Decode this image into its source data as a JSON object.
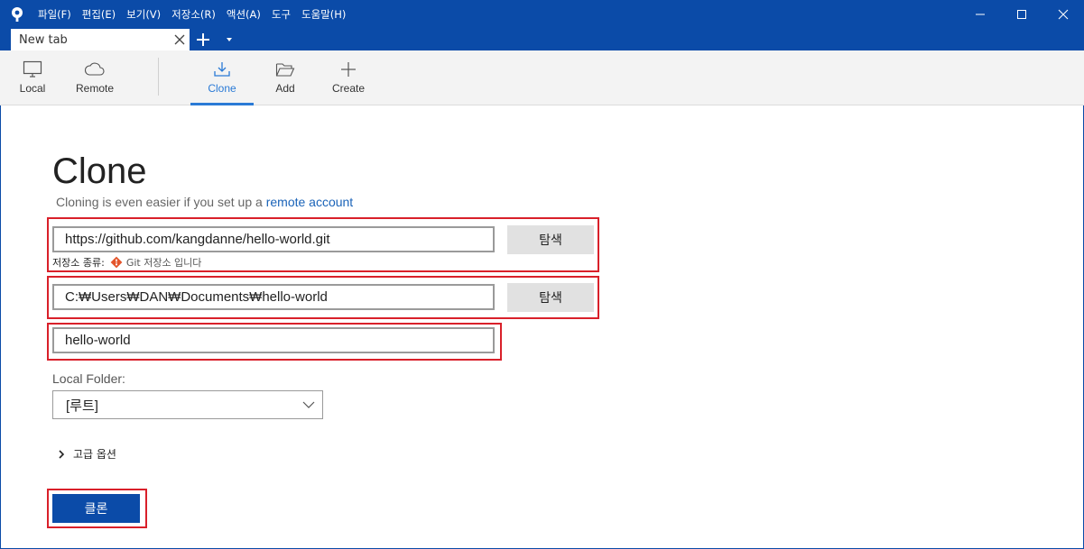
{
  "menu": {
    "items": [
      "파일(F)",
      "편집(E)",
      "보기(V)",
      "저장소(R)",
      "액션(A)",
      "도구",
      "도움말(H)"
    ]
  },
  "tabs": {
    "active_label": "New tab"
  },
  "toolbar": {
    "local": "Local",
    "remote": "Remote",
    "clone": "Clone",
    "add": "Add",
    "create": "Create"
  },
  "clone_page": {
    "title": "Clone",
    "subtitle_prefix": "Cloning is even easier if you set up a",
    "subtitle_link": "remote account",
    "source_url": "https://github.com/kangdanne/hello-world.git",
    "browse_label": "탐색",
    "repo_type_label": "저장소 종류:",
    "repo_type_value": "Git 저장소 입니다",
    "dest_path": "C:₩Users₩DAN₩Documents₩hello-world",
    "name_value": "hello-world",
    "local_folder_label": "Local Folder:",
    "local_folder_selected": "[루트]",
    "advanced_label": "고급 옵션",
    "clone_button_label": "클론"
  },
  "colors": {
    "accent": "#0b4ba8",
    "highlight": "#d9202a",
    "link": "#1a63b8",
    "git": "#e4552b"
  }
}
